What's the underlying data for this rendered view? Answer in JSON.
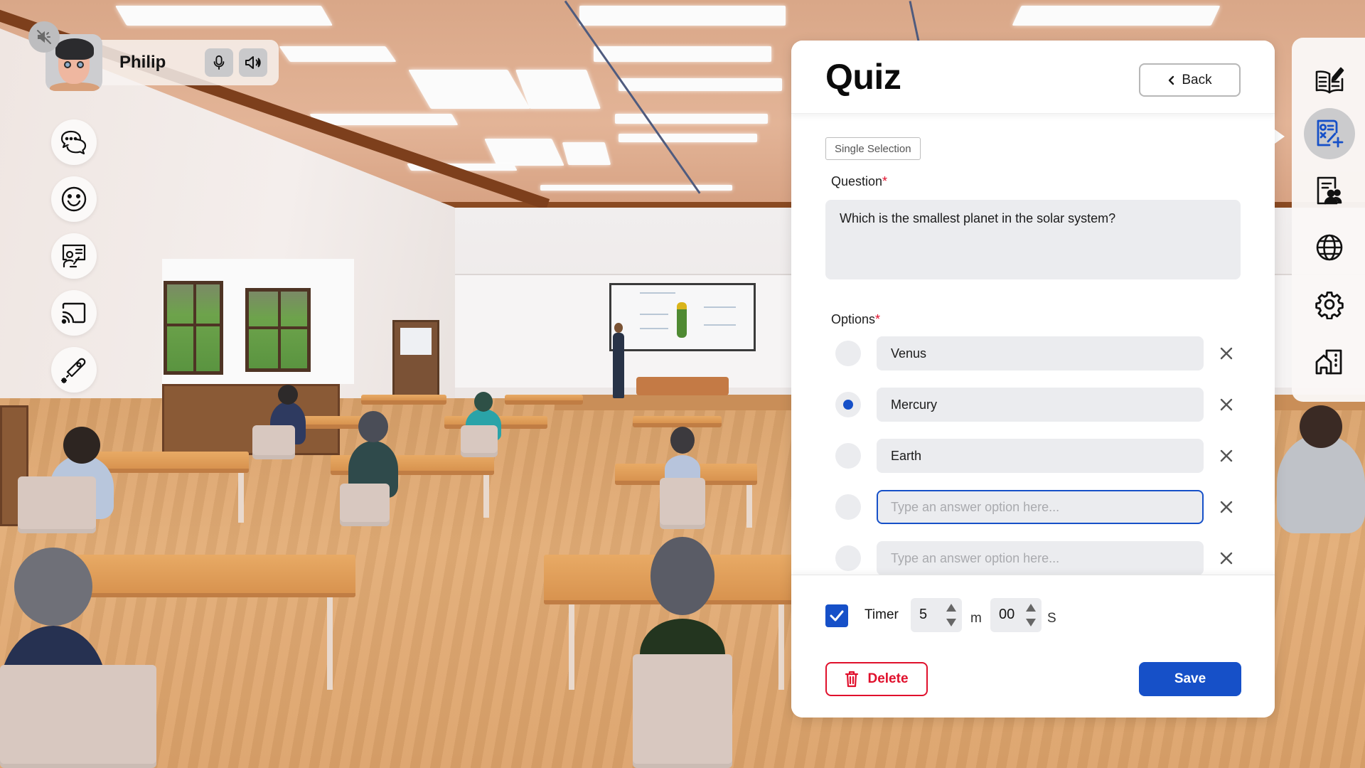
{
  "user": {
    "name": "Philip",
    "mute_badge_icon": "speaker-muted-icon",
    "mic_icon": "microphone-icon",
    "speaker_icon": "speaker-icon"
  },
  "left_toolbar": {
    "items": [
      {
        "name": "chat",
        "icon": "chat-bubbles-icon"
      },
      {
        "name": "reactions",
        "icon": "smiley-icon"
      },
      {
        "name": "presenter",
        "icon": "presenter-board-icon"
      },
      {
        "name": "screen-cast",
        "icon": "cast-icon"
      },
      {
        "name": "laser-pointer",
        "icon": "laser-pointer-icon"
      }
    ]
  },
  "right_sidebar": {
    "items": [
      {
        "name": "lesson",
        "icon": "book-edit-icon",
        "active": false
      },
      {
        "name": "quiz",
        "icon": "quiz-add-icon",
        "active": true
      },
      {
        "name": "attendance",
        "icon": "document-users-icon",
        "active": false
      },
      {
        "name": "language",
        "icon": "globe-icon",
        "active": false
      },
      {
        "name": "settings",
        "icon": "gear-icon",
        "active": false
      },
      {
        "name": "rooms",
        "icon": "buildings-icon",
        "active": false
      }
    ],
    "active_color": "#1650c8"
  },
  "quiz": {
    "title": "Quiz",
    "back_label": "Back",
    "question_type": "Single Selection",
    "question_label": "Question",
    "question_value": "Which is the smallest planet in the solar system?",
    "options_label": "Options",
    "required_marker": "*",
    "options": [
      {
        "value": "Venus",
        "placeholder": "Type an answer option here...",
        "correct": false
      },
      {
        "value": "Mercury",
        "placeholder": "Type an answer option here...",
        "correct": true
      },
      {
        "value": "Earth",
        "placeholder": "Type an answer option here...",
        "correct": false
      },
      {
        "value": "",
        "placeholder": "Type an answer option here...",
        "correct": false,
        "focused": true
      },
      {
        "value": "",
        "placeholder": "Type an answer option here...",
        "correct": false
      }
    ],
    "timer": {
      "enabled": true,
      "label": "Timer",
      "minutes": "5",
      "minutes_unit": "m",
      "seconds": "00",
      "seconds_unit": "S"
    },
    "delete_label": "Delete",
    "save_label": "Save"
  },
  "colors": {
    "accent": "#1650c8",
    "danger": "#e0102c",
    "input_bg": "#ebecef"
  }
}
